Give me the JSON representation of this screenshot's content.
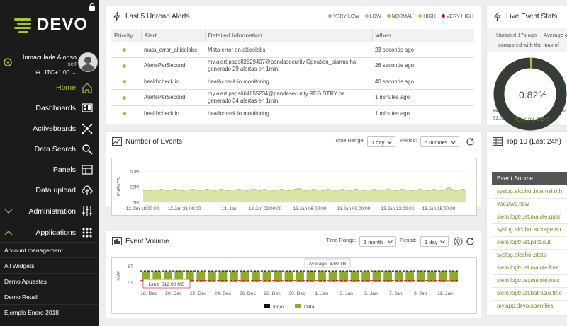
{
  "brand": {
    "name": "DEVO"
  },
  "user": {
    "name": "Inmaculada Alonso",
    "role": "self",
    "timezone": "UTC+1:00"
  },
  "nav": [
    {
      "label": "Home",
      "icon": "home-icon"
    },
    {
      "label": "Dashboards",
      "icon": "dashboards-icon"
    },
    {
      "label": "Activeboards",
      "icon": "activeboards-icon"
    },
    {
      "label": "Data Search",
      "icon": "search-icon"
    },
    {
      "label": "Panels",
      "icon": "panels-icon"
    },
    {
      "label": "Data upload",
      "icon": "upload-icon"
    },
    {
      "label": "Administration",
      "icon": "sliders-icon"
    },
    {
      "label": "Applications",
      "icon": "apps-grid-icon"
    }
  ],
  "applications": [
    "Account management",
    "All Widgets",
    "Demo Apuestas",
    "Demo Retail",
    "Ejemplo Enero 2018"
  ],
  "alerts": {
    "title": "Last 5 Unread Alerts",
    "legend": [
      {
        "label": "VERY LOW",
        "color": "#9ea5c6"
      },
      {
        "label": "LOW",
        "color": "#7ec8e3"
      },
      {
        "label": "NORMAL",
        "color": "#8dc63f"
      },
      {
        "label": "HIGH",
        "color": "#f0a830"
      },
      {
        "label": "VERY HIGH",
        "color": "#d0021b"
      }
    ],
    "columns": [
      "Priority",
      "Alert",
      "Detailed Information",
      "When"
    ],
    "rows": [
      {
        "alert": "mata_error_alticelabs",
        "info": "Mata error on alticelabs",
        "when": "23 seconds ago"
      },
      {
        "alert": "AlertsPerSecond",
        "info": "my.alert.paps82829407@pandasecurity.Opeation_alarms ha generado 29 alertas en 1min",
        "when": "26 seconds ago"
      },
      {
        "alert": "healthcheck.io",
        "info": "heathcheck.io monitoring",
        "when": "40 seconds ago"
      },
      {
        "alert": "AlertsPerSecond",
        "info": "my.alert.paps664655234@pandasecurity.REGISTRY ha generado 34 alertas en 1min",
        "when": "1 minutes ago"
      },
      {
        "alert": "healthcheck.io",
        "info": "heathcheck.io monitoring",
        "when": "1 minutes ago"
      }
    ]
  },
  "events": {
    "title": "Number of Events",
    "time_range_label": "Time Range:",
    "time_range_value": "1 day",
    "period_label": "Period:",
    "period_value": "5 minutes"
  },
  "volume": {
    "title": "Event Volume",
    "time_range_label": "Time Range:",
    "time_range_value": "1 month",
    "period_label": "Period:",
    "period_value": "1 day",
    "average_label": "Average: 3.69 TB",
    "limit_label": "Limit: 512.00 MB"
  },
  "live": {
    "title": "Live Event Stats",
    "updated": "Updated 17s ago",
    "average": "Average o",
    "compared": "compared with the max of",
    "percent": "0.82%",
    "min_label": "MIN",
    "min_value": "53,288",
    "max_label": "M",
    "eps": "53,924 EPS"
  },
  "top10": {
    "title": "Top 10 (Last 24h)",
    "header": "Event Source",
    "items": [
      "syslog.alcohol.internal.oth",
      "vpc.aws.flow",
      "siem.logtrust.malote.quer",
      "syslog.alcohol.storage.op",
      "siem.logtrust.pilot.out",
      "syslog.alcohol.stats",
      "siem.logtrust.malote.free",
      "siem.logtrust.malote.outc",
      "siem.logtrust.batrasio.free",
      "my.app.devo.openfiles"
    ]
  },
  "colors": {
    "accent": "#a7c33a",
    "bar": "#8dac2e",
    "limit": "#d0021b"
  },
  "chart_data": [
    {
      "type": "area",
      "title": "Number of Events",
      "ylabel": "EVENTS",
      "ylim": [
        0,
        50000000
      ],
      "y_ticks": [
        "50M",
        "25M",
        "0M"
      ],
      "x_ticks": [
        "12.Jan 18:00:00",
        "12.Jan 21:00:00",
        "13. Jan",
        "13.Jan 03:00:00",
        "13.Jan 06:00:00",
        "13.Jan 09:00:00",
        "13.Jan 12:00:00",
        "13.Jan 15:00:00"
      ],
      "series": [
        {
          "values": [
            19,
            20,
            19,
            20,
            19,
            21,
            20,
            19,
            20,
            21,
            20,
            19,
            20,
            20,
            21,
            20,
            19,
            20,
            21,
            20,
            19,
            20,
            21,
            20,
            19,
            20,
            20,
            21,
            20,
            19,
            20,
            21,
            20,
            19,
            21,
            20,
            20,
            19,
            20,
            21,
            20,
            19,
            20,
            21,
            22,
            20,
            19,
            20,
            21,
            20,
            20,
            19,
            21,
            20,
            19,
            20,
            21,
            20,
            19,
            20,
            21,
            20,
            19,
            20,
            20,
            21,
            20,
            19,
            20,
            21,
            20,
            19,
            20,
            21,
            20,
            20,
            19,
            20,
            21,
            20,
            19,
            20,
            21,
            20,
            19,
            20,
            24,
            21,
            19,
            20,
            21,
            20
          ]
        }
      ]
    },
    {
      "type": "bar",
      "title": "Event Volume",
      "ylabel": "SIZE",
      "y_ticks": [
        "8T",
        "0T"
      ],
      "x_ticks": [
        "18. Dec",
        "20. Dec",
        "22. Dec",
        "24. Dec",
        "26. Dec",
        "28. Dec",
        "30. Dec",
        "1. Jan",
        "3. Jan",
        "5. Jan",
        "7. Jan",
        "9. Jan",
        "11. Jan"
      ],
      "series": [
        {
          "name": "Data",
          "values": [
            3.6,
            3.7,
            3.6,
            3.8,
            3.7,
            3.6,
            3.7,
            3.8,
            3.6,
            3.7,
            3.7,
            3.6,
            3.8,
            3.7,
            3.6,
            3.7,
            3.8,
            3.6,
            3.7,
            3.7,
            3.6,
            3.8,
            3.7,
            3.6,
            3.7,
            3.8,
            3.6,
            3.7,
            3.7
          ]
        },
        {
          "name": "Index",
          "values": []
        }
      ],
      "average": 3.69,
      "limit": 0.5
    }
  ]
}
